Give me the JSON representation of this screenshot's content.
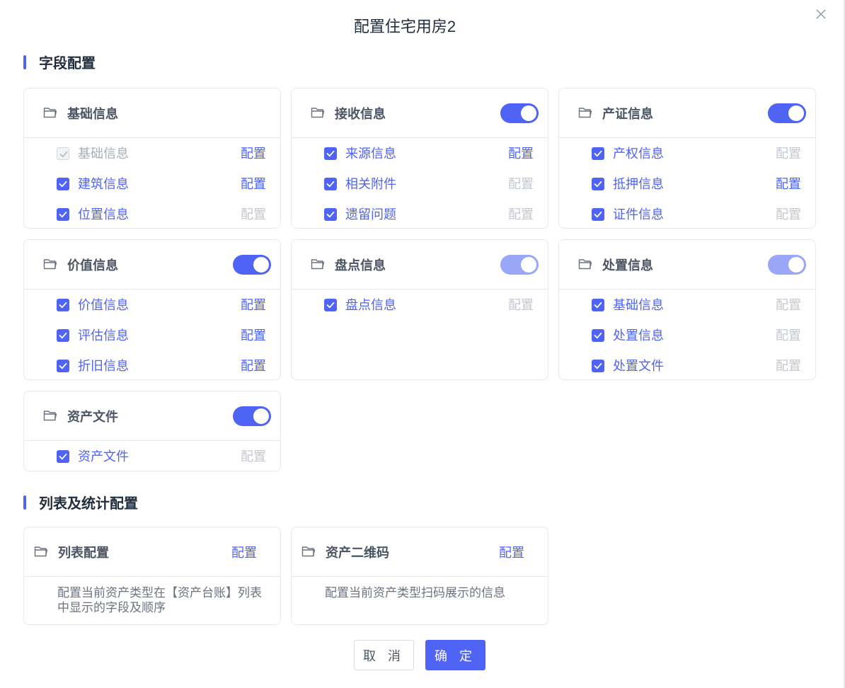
{
  "dialog": {
    "title": "配置住宅用房2",
    "close_icon": "close-icon"
  },
  "sections": {
    "field_config": "字段配置",
    "list_config": "列表及统计配置"
  },
  "cards": [
    {
      "title": "基础信息",
      "toggle": null,
      "rows": [
        {
          "label": "基础信息",
          "checked": true,
          "disabled": true,
          "action": "配置",
          "action_enabled": true
        },
        {
          "label": "建筑信息",
          "checked": true,
          "disabled": false,
          "action": "配置",
          "action_enabled": true
        },
        {
          "label": "位置信息",
          "checked": true,
          "disabled": false,
          "action": "配置",
          "action_enabled": false
        }
      ]
    },
    {
      "title": "接收信息",
      "toggle": "on",
      "rows": [
        {
          "label": "来源信息",
          "checked": true,
          "disabled": false,
          "action": "配置",
          "action_enabled": true
        },
        {
          "label": "相关附件",
          "checked": true,
          "disabled": false,
          "action": "配置",
          "action_enabled": false
        },
        {
          "label": "遗留问题",
          "checked": true,
          "disabled": false,
          "action": "配置",
          "action_enabled": false
        }
      ]
    },
    {
      "title": "产证信息",
      "toggle": "on",
      "rows": [
        {
          "label": "产权信息",
          "checked": true,
          "disabled": false,
          "action": "配置",
          "action_enabled": false
        },
        {
          "label": "抵押信息",
          "checked": true,
          "disabled": false,
          "action": "配置",
          "action_enabled": true
        },
        {
          "label": "证件信息",
          "checked": true,
          "disabled": false,
          "action": "配置",
          "action_enabled": false
        }
      ]
    },
    {
      "title": "价值信息",
      "toggle": "on",
      "rows": [
        {
          "label": "价值信息",
          "checked": true,
          "disabled": false,
          "action": "配置",
          "action_enabled": true
        },
        {
          "label": "评估信息",
          "checked": true,
          "disabled": false,
          "action": "配置",
          "action_enabled": true
        },
        {
          "label": "折旧信息",
          "checked": true,
          "disabled": false,
          "action": "配置",
          "action_enabled": true
        }
      ]
    },
    {
      "title": "盘点信息",
      "toggle": "on-disabled",
      "rows": [
        {
          "label": "盘点信息",
          "checked": true,
          "disabled": false,
          "action": "配置",
          "action_enabled": false
        }
      ]
    },
    {
      "title": "处置信息",
      "toggle": "on-disabled",
      "rows": [
        {
          "label": "基础信息",
          "checked": true,
          "disabled": false,
          "action": "配置",
          "action_enabled": false
        },
        {
          "label": "处置信息",
          "checked": true,
          "disabled": false,
          "action": "配置",
          "action_enabled": false
        },
        {
          "label": "处置文件",
          "checked": true,
          "disabled": false,
          "action": "配置",
          "action_enabled": false
        }
      ]
    },
    {
      "title": "资产文件",
      "toggle": "on",
      "rows": [
        {
          "label": "资产文件",
          "checked": true,
          "disabled": false,
          "action": "配置",
          "action_enabled": false
        }
      ]
    }
  ],
  "list_cards": [
    {
      "title": "列表配置",
      "action": "配置",
      "desc": "配置当前资产类型在【资产台账】列表中显示的字段及顺序"
    },
    {
      "title": "资产二维码",
      "action": "配置",
      "desc": "配置当前资产类型扫码展示的信息"
    }
  ],
  "buttons": {
    "cancel": "取 消",
    "ok": "确 定"
  },
  "colors": {
    "accent": "#4f63f5",
    "accent_dim": "#9aa6f8",
    "disabled_text": "#c3c7cf"
  }
}
